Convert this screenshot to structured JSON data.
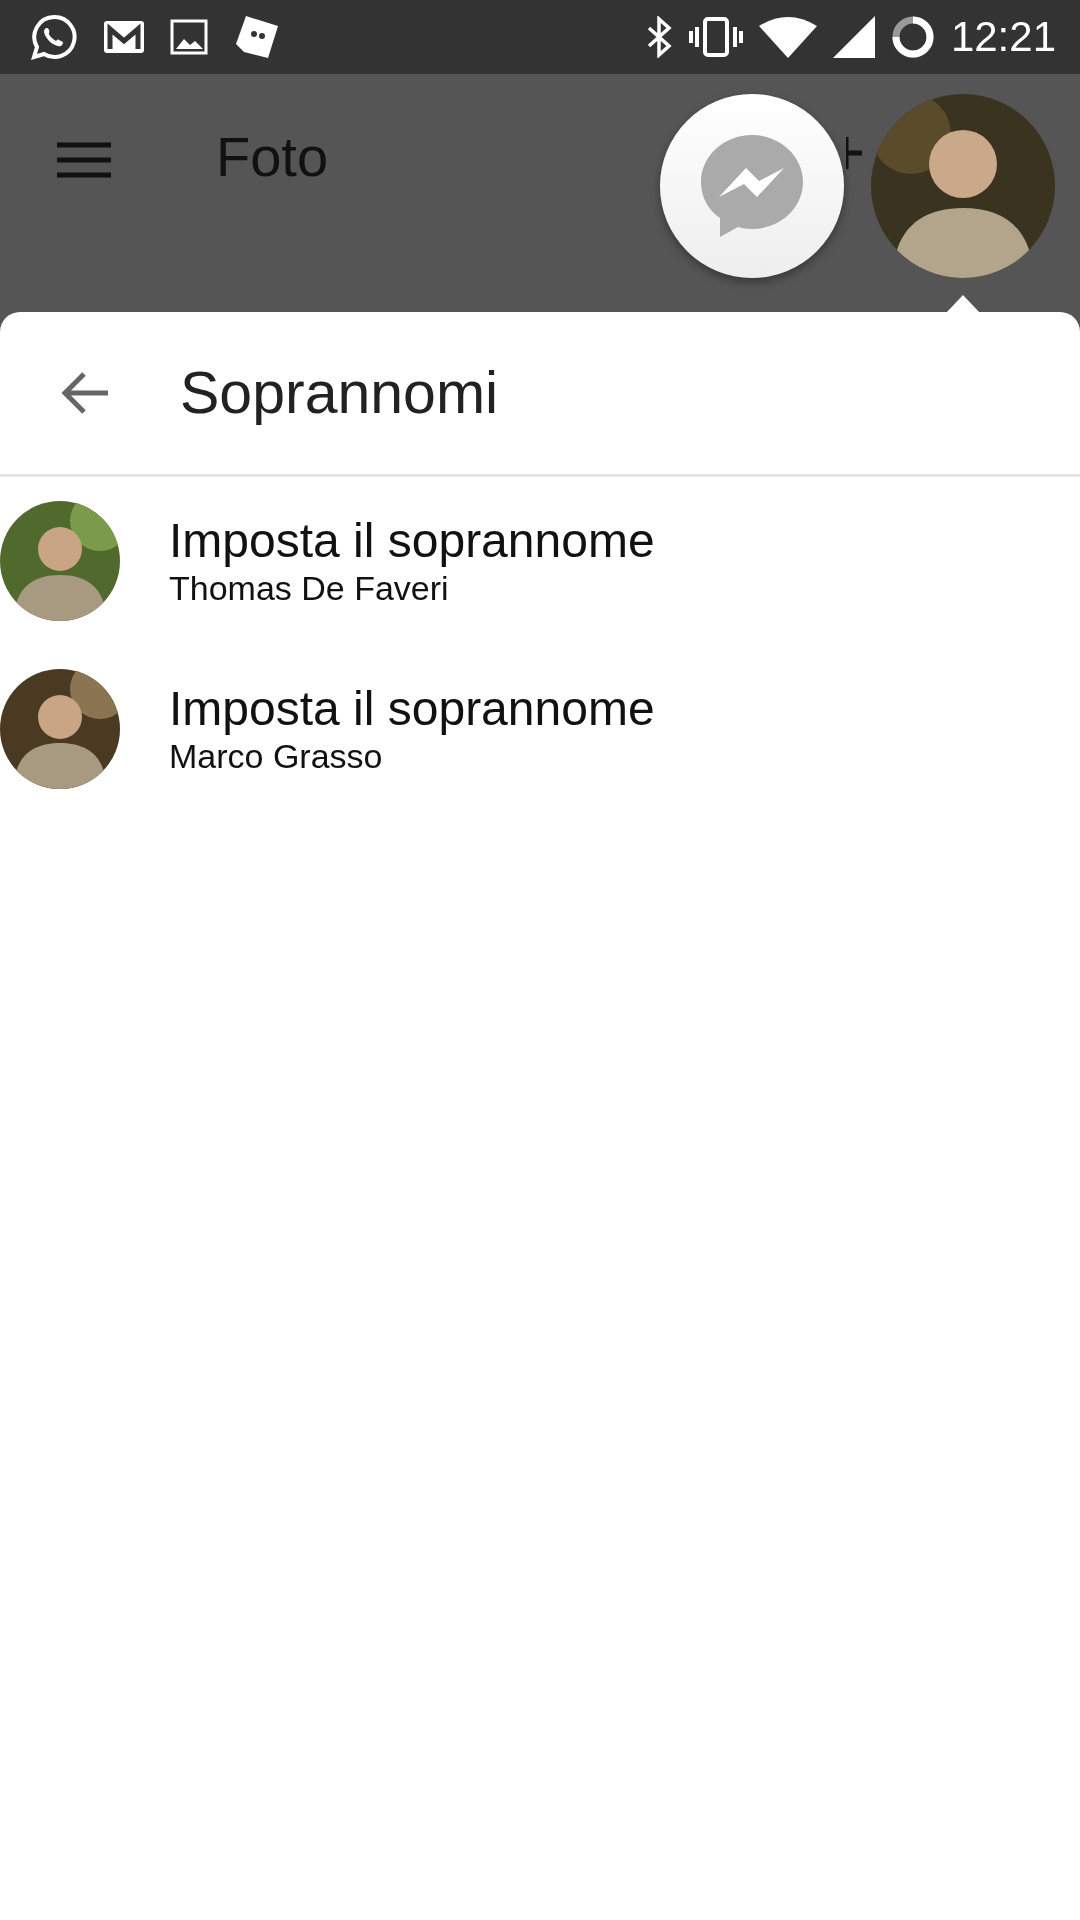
{
  "status_bar": {
    "time": "12:21"
  },
  "app_bar": {
    "title": "Foto"
  },
  "sheet": {
    "title": "Soprannomi",
    "rows": [
      {
        "title": "Imposta il soprannome",
        "subtitle": "Thomas De Faveri"
      },
      {
        "title": "Imposta il soprannome",
        "subtitle": "Marco Grasso"
      }
    ]
  }
}
